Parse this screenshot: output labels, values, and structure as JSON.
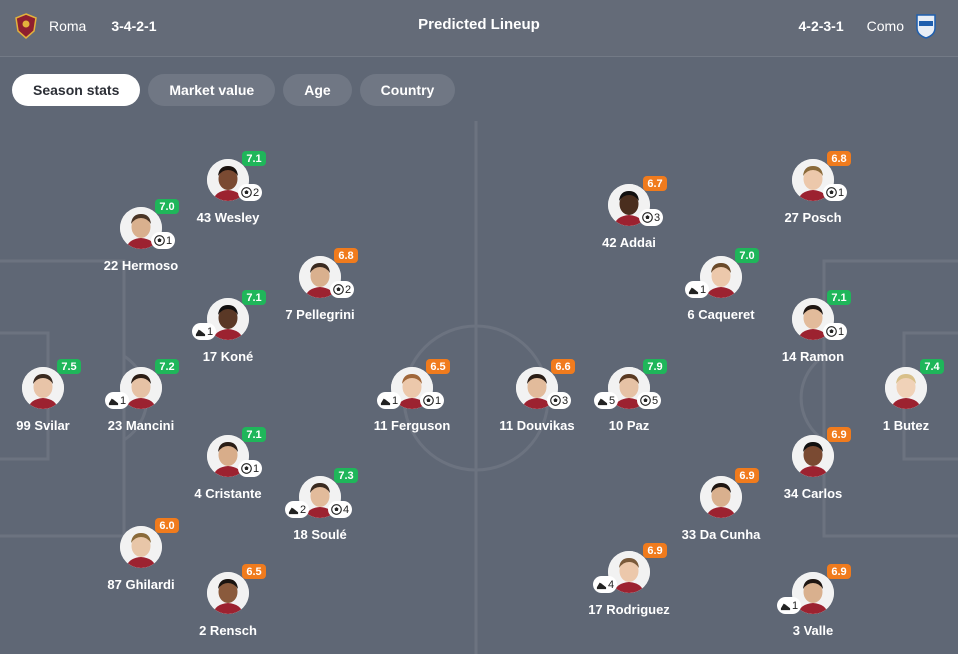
{
  "header": {
    "title": "Predicted Lineup",
    "home": {
      "name": "Roma",
      "formation": "3-4-2-1",
      "crest_color": "#8e1f2f"
    },
    "away": {
      "name": "Como",
      "formation": "4-2-3-1",
      "crest_color": "#1f5fae"
    }
  },
  "tabs": [
    {
      "label": "Season stats",
      "active": true
    },
    {
      "label": "Market value",
      "active": false
    },
    {
      "label": "Age",
      "active": false
    },
    {
      "label": "Country",
      "active": false
    }
  ],
  "colors": {
    "rating_green": "#1fb65a",
    "rating_orange": "#f07b1d",
    "pitch": "#5f6775",
    "lines": "#6c7380"
  },
  "players": [
    {
      "name": "99 Svilar",
      "rating": "7.5",
      "grade": "green",
      "skin": "#e8c4a8",
      "hair": "#3a2a20",
      "goals": null,
      "assists": null
    },
    {
      "name": "22 Hermoso",
      "rating": "7.0",
      "grade": "green",
      "skin": "#d9b08e",
      "hair": "#4a3526",
      "goals": "1",
      "assists": null
    },
    {
      "name": "23 Mancini",
      "rating": "7.2",
      "grade": "green",
      "skin": "#e6c2a5",
      "hair": "#2b1d15",
      "goals": null,
      "assists": "1"
    },
    {
      "name": "87 Ghilardi",
      "rating": "6.0",
      "grade": "orange",
      "skin": "#e8c6a8",
      "hair": "#8a6a3a",
      "goals": null,
      "assists": null
    },
    {
      "name": "43 Wesley",
      "rating": "7.1",
      "grade": "green",
      "skin": "#7a4a32",
      "hair": "#1a120e",
      "goals": "2",
      "assists": null
    },
    {
      "name": "17 Koné",
      "rating": "7.1",
      "grade": "green",
      "skin": "#5a3826",
      "hair": "#121010",
      "goals": null,
      "assists": "1"
    },
    {
      "name": "4 Cristante",
      "rating": "7.1",
      "grade": "green",
      "skin": "#d8ad8a",
      "hair": "#2a1d16",
      "goals": "1",
      "assists": null
    },
    {
      "name": "2 Rensch",
      "rating": "6.5",
      "grade": "orange",
      "skin": "#8a5a3c",
      "hair": "#1a1410",
      "goals": null,
      "assists": null
    },
    {
      "name": "7 Pellegrini",
      "rating": "6.8",
      "grade": "orange",
      "skin": "#d9b08e",
      "hair": "#3a2a20",
      "goals": "2",
      "assists": null
    },
    {
      "name": "18 Soulé",
      "rating": "7.3",
      "grade": "green",
      "skin": "#e2bb9b",
      "hair": "#3a2a20",
      "goals": "4",
      "assists": "2"
    },
    {
      "name": "11 Ferguson",
      "rating": "6.5",
      "grade": "orange",
      "skin": "#ecc8ab",
      "hair": "#a0673a",
      "goals": "1",
      "assists": "1"
    },
    {
      "name": "11 Douvikas",
      "rating": "6.6",
      "grade": "orange",
      "skin": "#e2bb9b",
      "hair": "#2a1d16",
      "goals": "3",
      "assists": null
    },
    {
      "name": "10 Paz",
      "rating": "7.9",
      "grade": "green",
      "skin": "#e6c2a5",
      "hair": "#5a3a22",
      "goals": "5",
      "assists": "5"
    },
    {
      "name": "42 Addai",
      "rating": "6.7",
      "grade": "orange",
      "skin": "#4a2e1e",
      "hair": "#121010",
      "goals": "3",
      "assists": null
    },
    {
      "name": "6 Caqueret",
      "rating": "7.0",
      "grade": "green",
      "skin": "#ecc8ab",
      "hair": "#6a4a2a",
      "goals": null,
      "assists": "1"
    },
    {
      "name": "17 Rodriguez",
      "rating": "6.9",
      "grade": "orange",
      "skin": "#ecc8ab",
      "hair": "#7a5a3a",
      "goals": null,
      "assists": "4"
    },
    {
      "name": "33 Da Cunha",
      "rating": "6.9",
      "grade": "orange",
      "skin": "#d9b08e",
      "hair": "#1f1612",
      "goals": null,
      "assists": null
    },
    {
      "name": "27 Posch",
      "rating": "6.8",
      "grade": "orange",
      "skin": "#ecc8ab",
      "hair": "#8a6a3a",
      "goals": "1",
      "assists": null
    },
    {
      "name": "14 Ramon",
      "rating": "7.1",
      "grade": "green",
      "skin": "#e2bb9b",
      "hair": "#1f1612",
      "goals": "1",
      "assists": null
    },
    {
      "name": "34 Carlos",
      "rating": "6.9",
      "grade": "orange",
      "skin": "#7a4a32",
      "hair": "#121010",
      "goals": null,
      "assists": null
    },
    {
      "name": "3 Valle",
      "rating": "6.9",
      "grade": "orange",
      "skin": "#d9b08e",
      "hair": "#1f1612",
      "goals": null,
      "assists": "1"
    },
    {
      "name": "1 Butez",
      "rating": "7.4",
      "grade": "green",
      "skin": "#f0d2b8",
      "hair": "#d8c08a",
      "goals": null,
      "assists": null
    }
  ]
}
